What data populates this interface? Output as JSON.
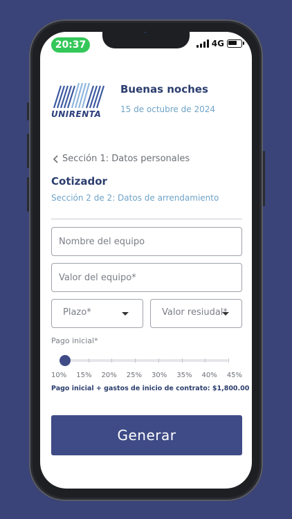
{
  "status_bar": {
    "time": "20:37",
    "network": "4G",
    "battery_level": 0.7
  },
  "header": {
    "logo_text": "UNIRENTA",
    "greeting": "Buenas noches",
    "date": "15 de octubre de 2024"
  },
  "nav": {
    "back_label": "Sección 1: Datos personales"
  },
  "page": {
    "title": "Cotizador",
    "subtitle": "Sección 2 de 2: Datos de arrendamiento"
  },
  "form": {
    "equipment_name": {
      "placeholder": "Nombre del equipo",
      "value": ""
    },
    "equipment_value": {
      "placeholder": "Valor del equipo*",
      "value": ""
    },
    "term": {
      "label": "Plazo*"
    },
    "residual": {
      "label": "Valor resiudal*"
    }
  },
  "down_payment": {
    "label": "Pago inicial*",
    "ticks": [
      "10%",
      "15%",
      "20%",
      "25%",
      "30%",
      "35%",
      "40%",
      "45%"
    ],
    "selected_index": 0,
    "summary": "Pago inicial + gastos de inicio de contrato: $1,800.00"
  },
  "actions": {
    "generate_label": "Generar"
  },
  "colors": {
    "primary": "#3f4b86",
    "accent_light": "#6fa3c8",
    "background": "#3a4478",
    "status_pill": "#34c759"
  }
}
